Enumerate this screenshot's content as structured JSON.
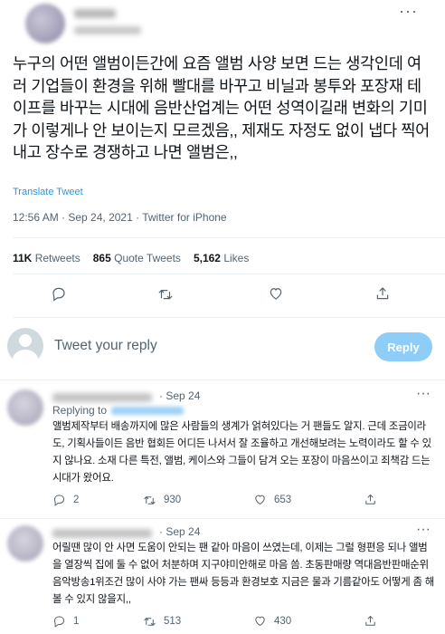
{
  "tweet": {
    "more_label": "···",
    "body": "누구의 어떤 앨범이든간에 요즘 앨범 사양 보면 드는 생각인데 여러 기업들이 환경을 위해 빨대를 바꾸고 비닐과 봉투와 포장재 테이프를 바꾸는 시대에 음반산업계는 어떤 성역이길래 변화의 기미가 이렇게나 안 보이는지 모르겠음,, 제재도 자정도 없이 냅다 찍어내고 장수로 경쟁하고 나면 앨범은,,",
    "translate": "Translate Tweet",
    "meta": "12:56 AM · Sep 24, 2021 · Twitter for iPhone",
    "stats": {
      "retweets_count": "11K",
      "retweets_label": "Retweets",
      "quotes_count": "865",
      "quotes_label": "Quote Tweets",
      "likes_count": "5,162",
      "likes_label": "Likes"
    }
  },
  "reply_box": {
    "placeholder": "Tweet your reply",
    "button": "Reply"
  },
  "replies": [
    {
      "date": "· Sep 24",
      "replying_to": "Replying to",
      "text": "앨범제작부터 배송까지에 많은 사람들의 생계가 얽혀있다는 거 팬들도 알지. 근데 조금이라도, 기획사들이든 음반 협회든 어디든 나서서 잘 조율하고 개선해보려는 노력이라도 할 수 있지 않나요. 소재 다른 특전, 앨범, 케이스와 그들이 담겨 오는 포장이 마음쓰이고 죄책감 드는 시대가 왔어요.",
      "replies_count": "2",
      "retweets_count": "930",
      "likes_count": "653"
    },
    {
      "date": "· Sep 24",
      "text": "어릴땐 많이 안 사면 도움이 안되는 팬 같아 마음이 쓰였는데, 이제는 그럴 형편응 되나 앨범을 열장씩 집에 둘 수 없어 처분하며 지구야미안해로 마음 씀. 초동판매량 역대음반판매순위 음악방송1위조건 많이 사야 가는 팬싸 등등과 환경보호 지금은 물과 기름같아도 어떻게 좀 해볼 수 있지 않을지,,",
      "replies_count": "1",
      "retweets_count": "513",
      "likes_count": "430"
    }
  ]
}
